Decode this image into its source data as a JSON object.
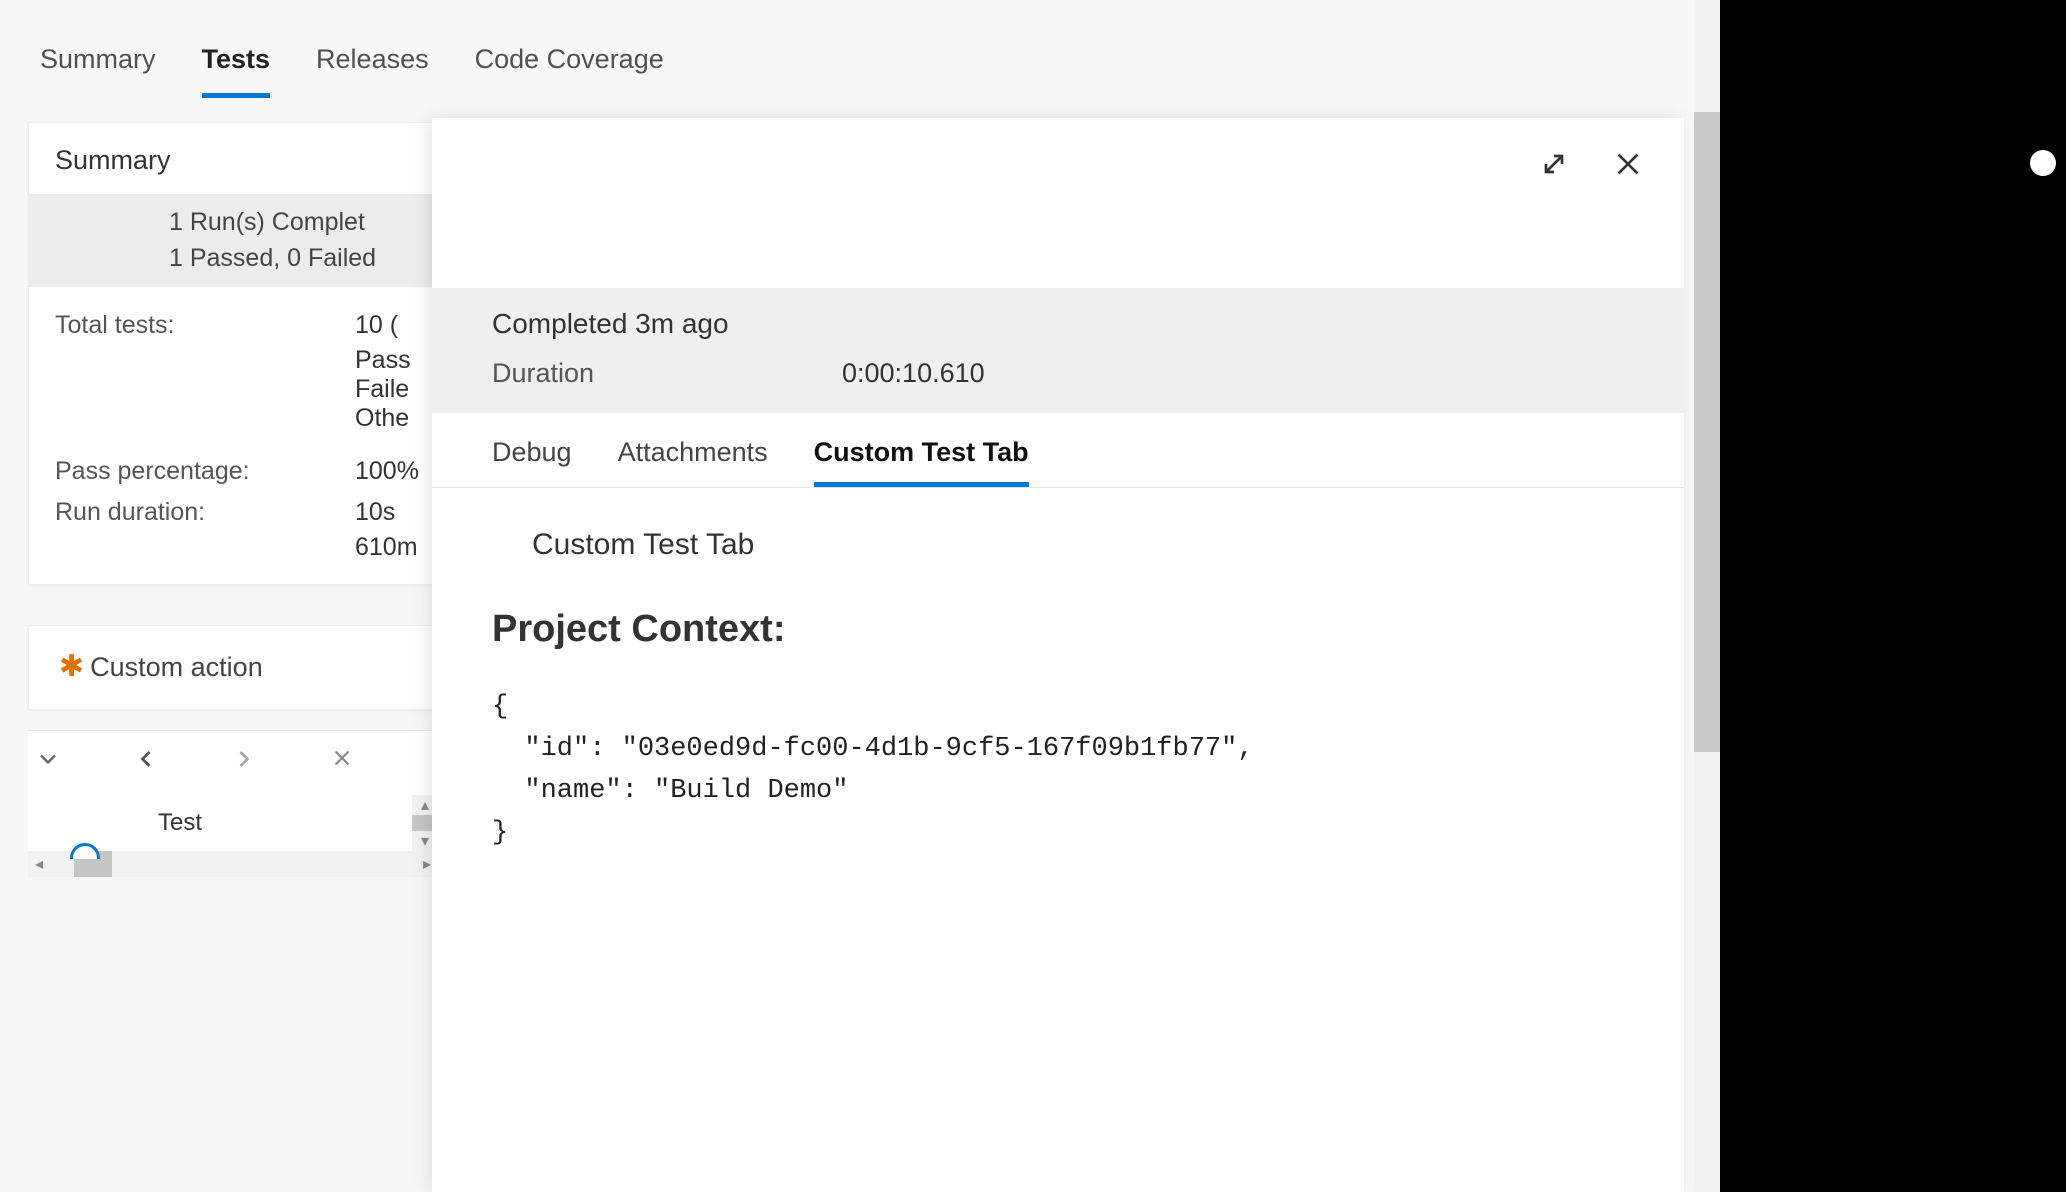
{
  "tabs": {
    "summary": "Summary",
    "tests": "Tests",
    "releases": "Releases",
    "coverage": "Code Coverage"
  },
  "summary": {
    "heading": "Summary",
    "line1": "1 Run(s) Complet",
    "line2": "1 Passed, 0 Failed",
    "total_label": "Total tests:",
    "total_value": "10 (",
    "total_sub1": "Pass",
    "total_sub2": "Faile",
    "total_sub3": "Othe",
    "pass_pct_label": "Pass percentage:",
    "pass_pct_value": "100%",
    "duration_label": "Run duration:",
    "duration_value": "10s",
    "duration_sub": "610m"
  },
  "custom_action": {
    "label": "Custom action"
  },
  "nav": {
    "test_label": "Test"
  },
  "flyout": {
    "completed": "Completed 3m ago",
    "duration_label": "Duration",
    "duration_value": "0:00:10.610",
    "tabs": {
      "debug": "Debug",
      "attachments": "Attachments",
      "custom": "Custom Test Tab"
    },
    "subheading": "Custom Test Tab",
    "context_heading": "Project Context:",
    "json_text": "{\n  \"id\": \"03e0ed9d-fc00-4d1b-9cf5-167f09b1fb77\",\n  \"name\": \"Build Demo\"\n}"
  }
}
